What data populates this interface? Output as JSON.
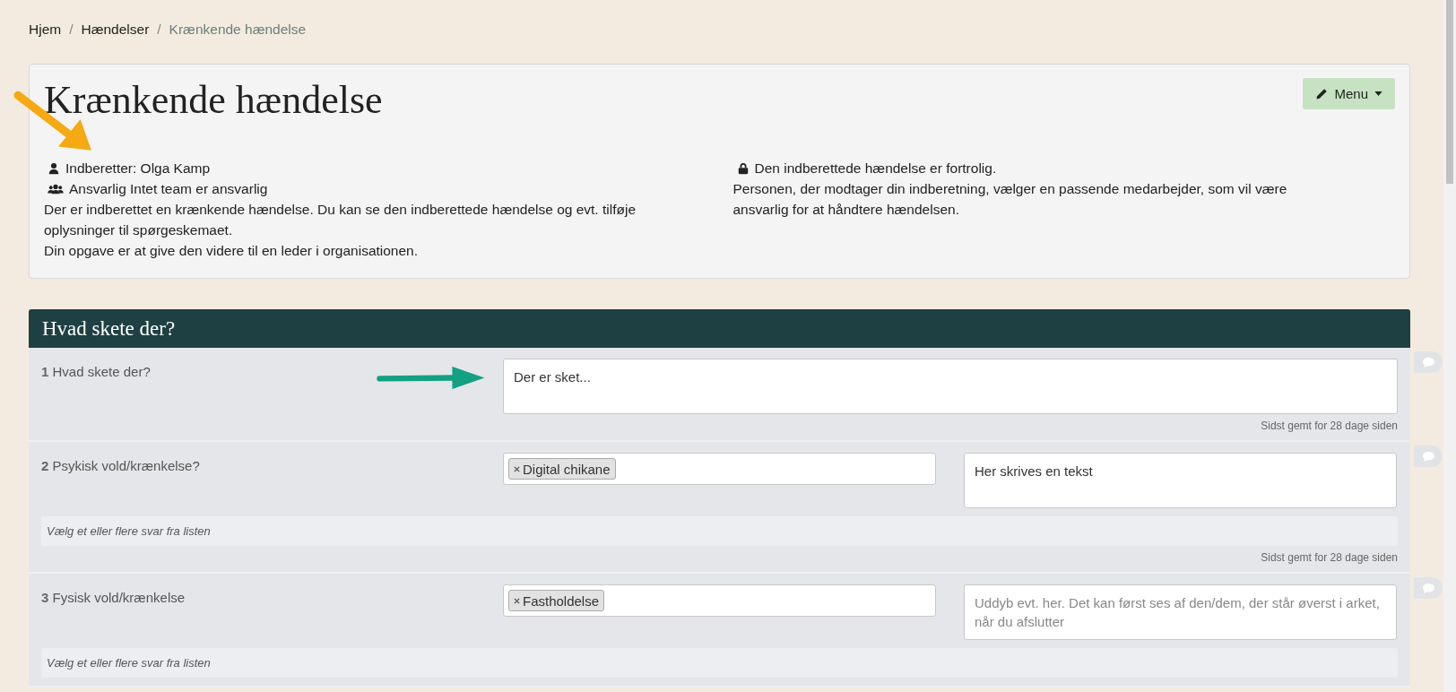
{
  "breadcrumb_separator": "/",
  "breadcrumb": [
    {
      "label": "Hjem",
      "current": false
    },
    {
      "label": "Hændelser",
      "current": false
    },
    {
      "label": "Krænkende hændelse",
      "current": true
    }
  ],
  "header": {
    "title": "Krænkende hændelse",
    "menu_button": "Menu",
    "left": {
      "reporter": "Indberetter: Olga Kamp",
      "responsible": "Ansvarlig Intet team er ansvarlig",
      "paragraphs": [
        "Der er indberettet en krænkende hændelse. Du kan se den indberettede hændelse og evt. tilføje oplysninger til spørgeskemaet.",
        "Din opgave er at give den videre til en leder i organisationen."
      ]
    },
    "right": {
      "confidential": "Den indberettede hændelse er fortrolig.",
      "paragraphs": [
        "Personen, der modtager din indberetning, vælger en passende medarbejder, som vil være ansvarlig for at håndtere hændelsen."
      ]
    }
  },
  "section": {
    "title": "Hvad skete der?",
    "questions": [
      {
        "kind": "text",
        "number": "1",
        "label": "Hvad skete der?",
        "value": "Der er sket...",
        "saved": "Sidst gemt for 28 dage siden"
      },
      {
        "kind": "select",
        "number": "2",
        "label": "Psykisk vold/krænkelse?",
        "tags": [
          "Digital chikane"
        ],
        "value": "Her skrives en tekst",
        "hint": "Vælg et eller flere svar fra listen",
        "saved": "Sidst gemt for 28 dage siden"
      },
      {
        "kind": "select",
        "number": "3",
        "label": "Fysisk vold/krænkelse",
        "tags": [
          "Fastholdelse"
        ],
        "placeholder": "Uddyb evt. her. Det kan først ses af den/dem, der står øverst i arket, når du afslutter",
        "hint": "Vælg et eller flere svar fra listen"
      }
    ]
  }
}
